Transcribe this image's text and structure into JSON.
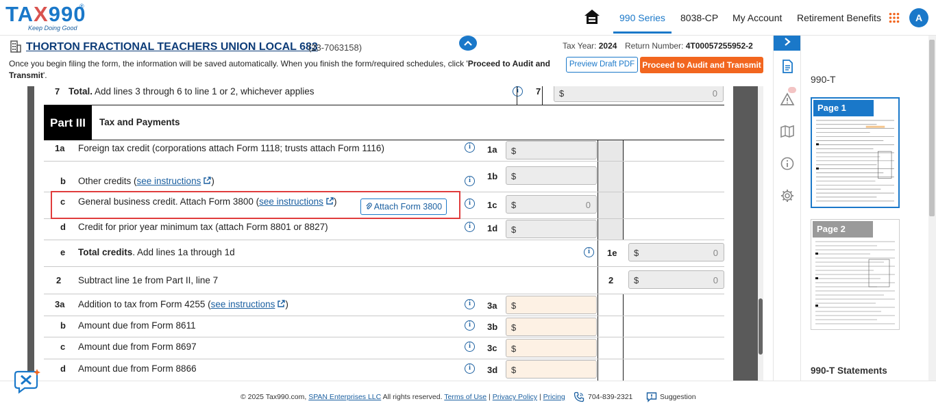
{
  "header": {
    "logo_text_1": "TA",
    "logo_text_x": "X",
    "logo_text_2": "990",
    "logo_reg": "®",
    "logo_tagline": "Keep Doing Good",
    "nav": [
      "990 Series",
      "8038-CP",
      "My Account",
      "Retirement Benefits"
    ],
    "active_nav": "990 Series",
    "avatar_initial": "A"
  },
  "org": {
    "name": "THORTON FRACTIONAL TEACHERS UNION LOCAL 683",
    "ein": "(23-7063158)",
    "tax_year_label": "Tax Year:",
    "tax_year": "2024",
    "return_number_label": "Return Number:",
    "return_number": "4T00057255952-2",
    "notice_pre": "Once you begin filing the form, the information will be saved automatically. When you finish the form/required schedules, click '",
    "notice_bold": "Proceed to Audit and Transmit",
    "notice_post": "'.",
    "preview_button": "Preview Draft PDF",
    "proceed_button": "Proceed to Audit and Transmit"
  },
  "form": {
    "line7": {
      "num": "7",
      "text_bold": "Total.",
      "text": " Add lines 3 through 6 to line 1 or 2, whichever applies",
      "code": "7",
      "currency": "$",
      "value": "0"
    },
    "part": {
      "tag": "Part III",
      "title": "Tax and Payments"
    },
    "lines": [
      {
        "num": "1a",
        "text": "Foreign tax credit (corporations attach Form 1118; trusts attach Form 1116)",
        "code": "1a",
        "currency": "$",
        "value": ""
      },
      {
        "num": "b",
        "text": "Other credits (",
        "link": "see instructions",
        "text_after": ")",
        "code": "1b",
        "currency": "$",
        "value": ""
      },
      {
        "num": "c",
        "text": "General business credit. Attach Form 3800 (",
        "link": "see instructions",
        "text_after": ")",
        "code": "1c",
        "currency": "$",
        "value": "0"
      },
      {
        "num": "d",
        "text": "Credit for prior year minimum tax (attach Form 8801 or 8827)",
        "code": "1d",
        "currency": "$",
        "value": ""
      },
      {
        "num": "e",
        "text_bold": "Total credits",
        "text": ". Add lines 1a through 1d",
        "code": "1e",
        "currency": "$",
        "value": "0"
      },
      {
        "num": "2",
        "text": "Subtract line 1e from Part II, line 7",
        "code": "2",
        "currency": "$",
        "value": "0"
      },
      {
        "num": "3a",
        "text": "Addition to tax from Form 4255 (",
        "link": "see instructions",
        "text_after": ")",
        "code": "3a",
        "currency": "$",
        "value": ""
      },
      {
        "num": "b",
        "text": "Amount due from Form 8611",
        "code": "3b",
        "currency": "$",
        "value": ""
      },
      {
        "num": "c",
        "text": "Amount due from Form 8697",
        "code": "3c",
        "currency": "$",
        "value": ""
      },
      {
        "num": "d",
        "text": "Amount due from Form 8866",
        "code": "3d",
        "currency": "$",
        "value": ""
      }
    ],
    "attach_button": "Attach Form 3800"
  },
  "side_panel": {
    "heading": "990-T",
    "pages": [
      "Page 1",
      "Page 2"
    ],
    "statements": "990-T Statements"
  },
  "footer": {
    "copyright": "© 2025 Tax990.com,",
    "company_link": "SPAN Enterprises LLC",
    "rights": "All rights reserved.",
    "terms": "Terms of Use",
    "privacy": "Privacy Policy",
    "pricing": "Pricing",
    "separator": "|",
    "phone": "704-839-2321",
    "suggestion": "Suggestion"
  },
  "colors": {
    "brand_blue": "#1a78c9",
    "accent_orange": "#f2661f",
    "highlight_red": "#e03c3c",
    "input_orange_bg": "#fdf1e4"
  }
}
